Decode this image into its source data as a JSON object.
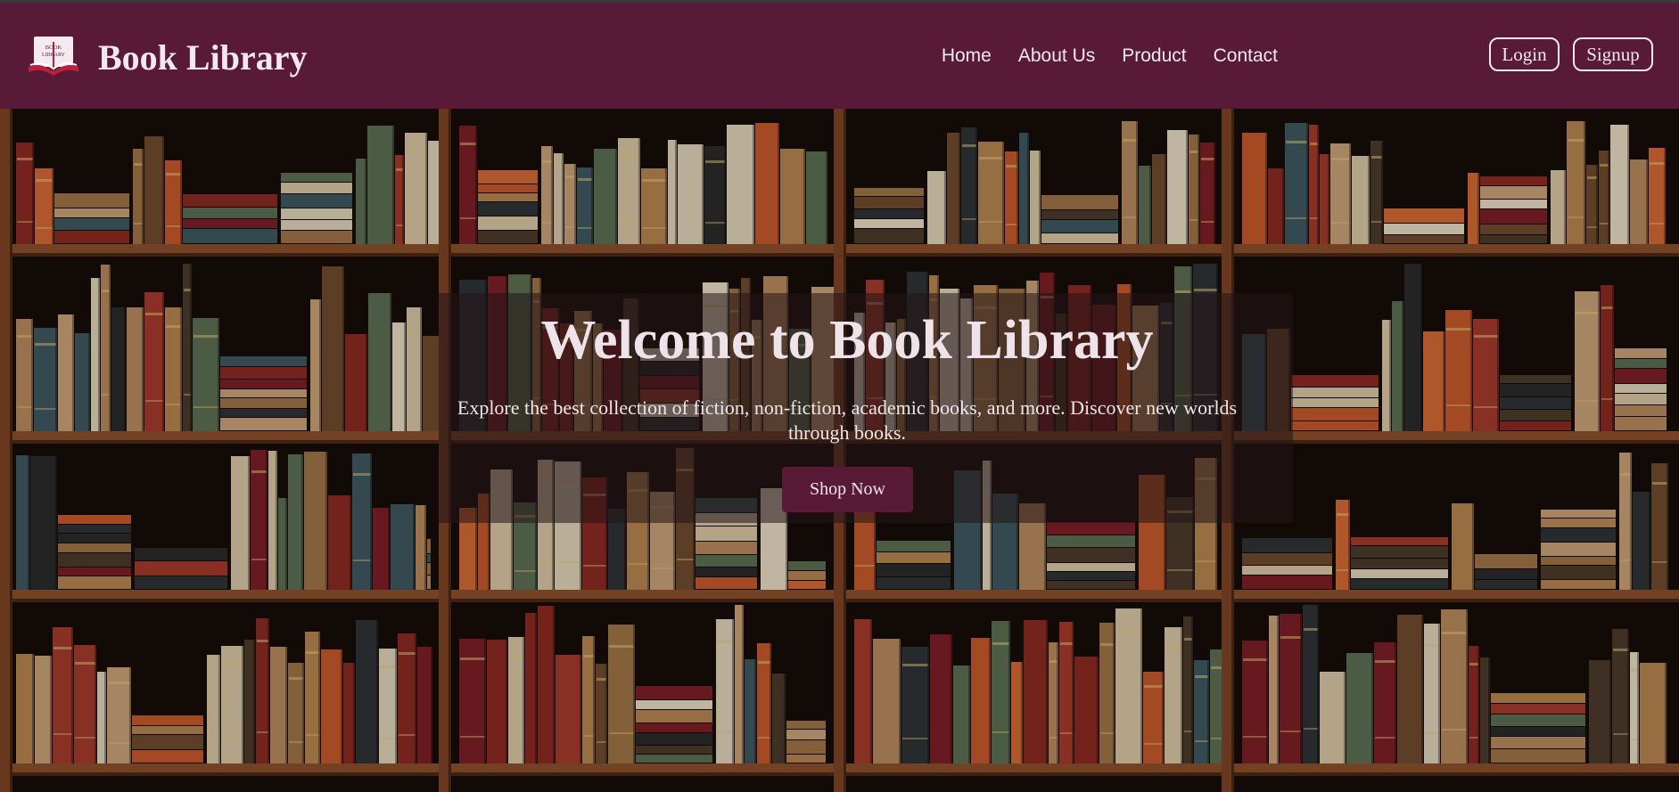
{
  "header": {
    "brand": "Book Library",
    "logo_icon": "open-book-icon",
    "logo_text": [
      "BOOK",
      "LIBRARY"
    ],
    "nav": [
      "Home",
      "About Us",
      "Product",
      "Contact"
    ],
    "login_label": "Login",
    "signup_label": "Signup"
  },
  "hero": {
    "title": "Welcome to Book Library",
    "subtitle": "Explore the best collection of fiction, non-fiction, academic books, and more. Discover new worlds through books.",
    "cta_label": "Shop Now",
    "background": "bookshelf-photo"
  },
  "colors": {
    "brand": "#591a37",
    "nav_text": "#f5e9ef",
    "shelf_wood": "#8a4f2a"
  }
}
